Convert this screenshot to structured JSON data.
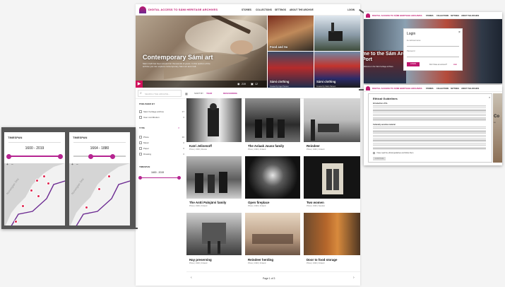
{
  "header": {
    "site_title": "DIGITAL ACCESS TO SÁMI HERITAGE ARCHIVES",
    "nav": [
      "STORIES",
      "COLLECTIONS",
      "SETTINGS",
      "ABOUT THE ARCHIVE"
    ],
    "login": "LOGIN"
  },
  "hero": {
    "title": "Contemporary Sámi art",
    "description": "Sámi craft has been around for thousands of years. In this section of the archive you can explore contemporary Sámi art and craft.",
    "likes": "219",
    "comments": "12",
    "tiles": [
      {
        "label": "Food and So",
        "sub": ""
      },
      {
        "label": "",
        "sub": ""
      },
      {
        "label": "Sámi clothing",
        "sub": "Created by Inger Hansen"
      },
      {
        "label": "Sámi clothing",
        "sub": "Created by Maria Hansen"
      }
    ]
  },
  "search": {
    "placeholder": "SEARCH THE ARCHIVE..."
  },
  "sort": {
    "label": "SORT BY",
    "value": "YEAR",
    "order": "DESCENDING"
  },
  "filters": {
    "publisher_head": "PUBLISHED BY",
    "publisher": [
      {
        "label": "Sámi heritage archive",
        "count": "37"
      },
      {
        "label": "User contribution",
        "count": "0"
      }
    ],
    "type_head": "TYPE",
    "types": [
      {
        "label": "Photo",
        "count": "36"
      },
      {
        "label": "Music",
        "count": "0"
      },
      {
        "label": "Paper",
        "count": "0"
      },
      {
        "label": "Drawing",
        "count": "0"
      }
    ],
    "timespan_head": "TIMESPAN",
    "timespan": "1600 - 2019"
  },
  "cards": [
    {
      "title": "Katri Jelinenoff",
      "sub": "Photo | 1930 | Russia"
    },
    {
      "title": "The Aslaak Juuso family",
      "sub": "Photo | 1930 | Finland"
    },
    {
      "title": "Reindeer",
      "sub": "Photo | 1930 | Finland"
    },
    {
      "title": "The Antti Palojärvi family",
      "sub": "Photo | 1930 | Finland"
    },
    {
      "title": "Open fireplace",
      "sub": "Photo | 1930 | Finland"
    },
    {
      "title": "Two women",
      "sub": "Photo | 1930 | Sweden"
    },
    {
      "title": "Hay preserving",
      "sub": "Photo | 1930 | Finland"
    },
    {
      "title": "Reindeer herding",
      "sub": "Photo | 1930 | Finland"
    },
    {
      "title": "Door to food storage",
      "sub": "Photo | 1930 | Finland"
    }
  ],
  "pagination": {
    "text": "Page 1 of 3"
  },
  "login_window": {
    "site_title": "DIGITAL ACCESS TO SÁMI HERITAGE ARCHIVES",
    "nav": [
      "STORIES",
      "COLLECTIONS",
      "SETTINGS",
      "ABOUT THE ARCHIVE"
    ],
    "hero_text": "me to the Sám Archives Port",
    "hero_sub": "Welcome to the Sámi heritage archives.",
    "dialog_title": "Login",
    "email_label": "E-mail/username",
    "password_label": "Password",
    "login_button": "LOGIN",
    "forgot": "Don't have an account?",
    "signup": "Join"
  },
  "guidelines_window": {
    "site_title": "DIGITAL ACCESS TO SÁMI HERITAGE ARCHIVES",
    "nav": [
      "STORIES",
      "COLLECTIONS",
      "SETTINGS",
      "ABOUT THE ARCHIVE"
    ],
    "title": "Ethical Guidelines",
    "section1": "Introduction of Ifa",
    "section2": "Culturally sensitive material",
    "agree": "I have read the ethical guidelines and follow them",
    "continue": "CONTINUE",
    "side_title": "Co",
    "side_sub": "Lo"
  },
  "zoom": {
    "left": {
      "head": "TIMESPAN",
      "range": "1600  -  2019",
      "labels": [
        "Norwegian Sea"
      ]
    },
    "right": {
      "head": "TIMESPAN",
      "range": "1664  -  1880",
      "labels": [
        "Norwegian Sea"
      ]
    }
  },
  "colors": {
    "accent": "#b62591",
    "brand": "#c0186f",
    "pin": "#e0264f",
    "border": "#6c2b92"
  }
}
